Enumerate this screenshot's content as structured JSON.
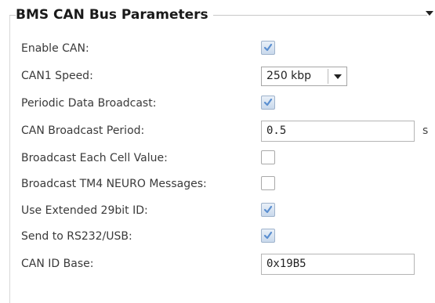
{
  "group": {
    "title": "BMS CAN Bus Parameters"
  },
  "colors": {
    "checkbox_checked": "#5b8fd0",
    "border": "#c8c8c8"
  },
  "fields": {
    "enable_can": {
      "label": "Enable CAN:",
      "checked": true
    },
    "can1_speed": {
      "label": "CAN1 Speed:",
      "value": "250 kbp",
      "icon": "chevron-down-icon"
    },
    "periodic_broadcast": {
      "label": "Periodic Data Broadcast:",
      "checked": true
    },
    "broadcast_period": {
      "label": "CAN Broadcast Period:",
      "value": "0.5",
      "unit": "s"
    },
    "broadcast_each_cell": {
      "label": "Broadcast Each Cell Value:",
      "checked": false
    },
    "broadcast_tm4": {
      "label": "Broadcast TM4 NEURO Messages:",
      "checked": false
    },
    "extended_id": {
      "label": "Use Extended 29bit ID:",
      "checked": true
    },
    "send_rs232": {
      "label": "Send to RS232/USB:",
      "checked": true
    },
    "can_id_base": {
      "label": "CAN ID Base:",
      "value": "0x19B5"
    }
  }
}
